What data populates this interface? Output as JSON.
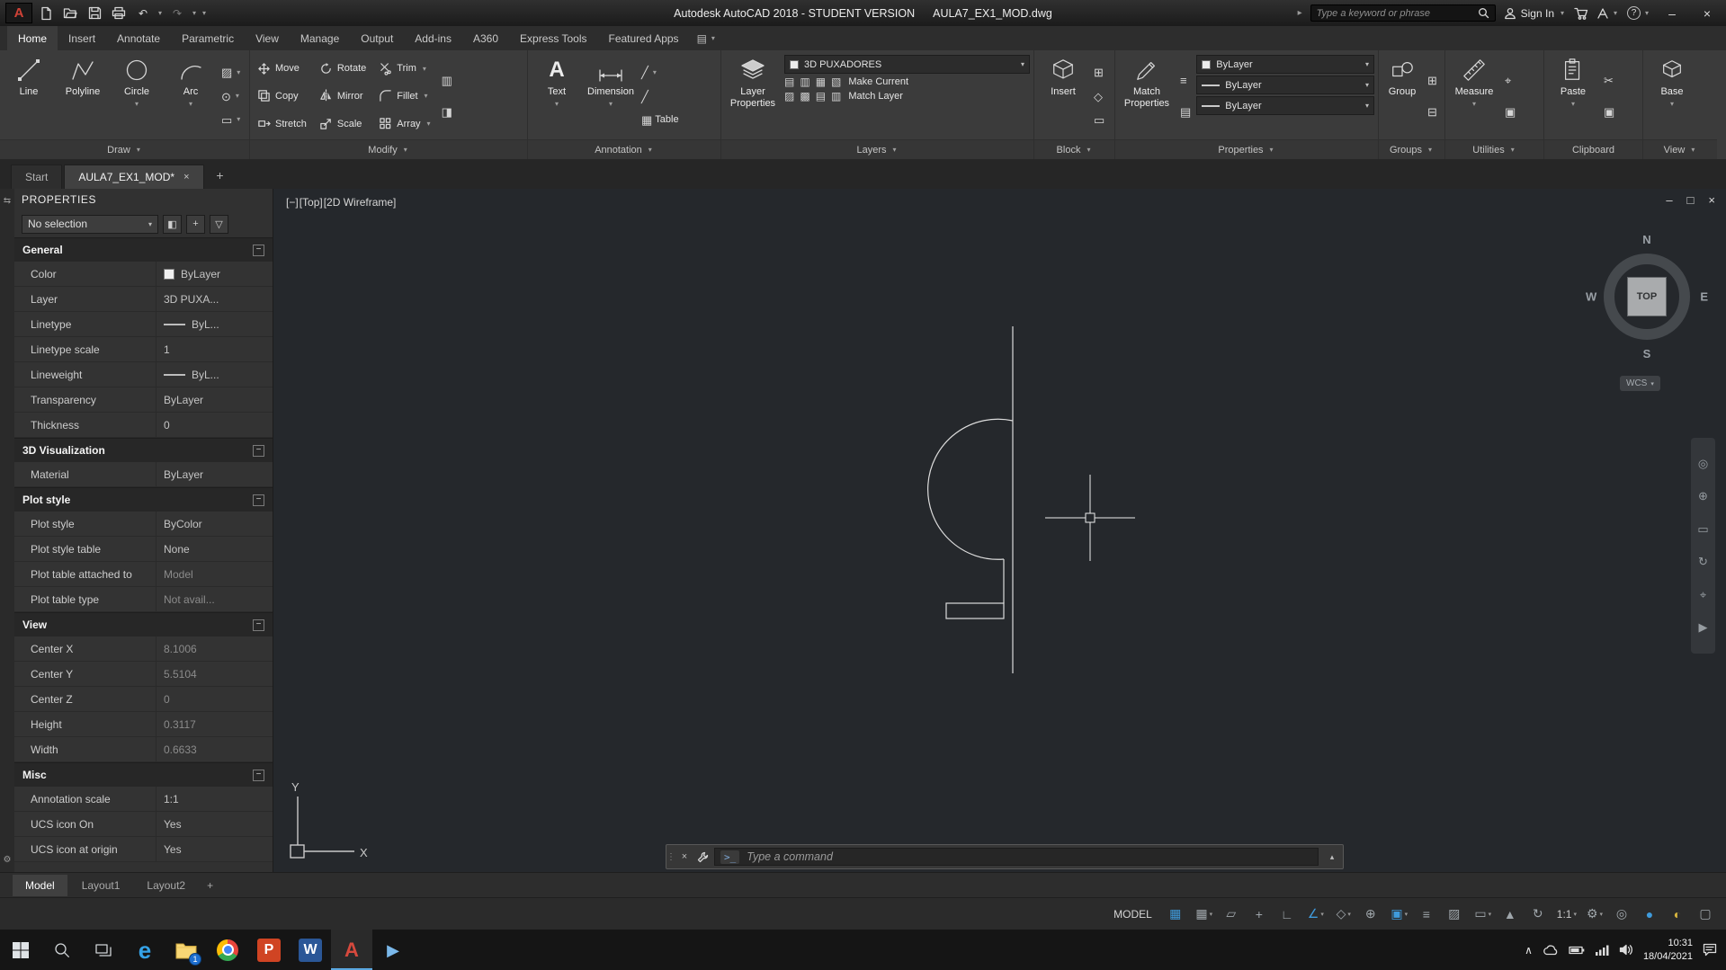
{
  "ui": {
    "caret": "▾",
    "caret_up": "▴",
    "minimize": "–",
    "maximize": "□",
    "close": "×",
    "plus": "+",
    "minus": "−",
    "chevron_right": "▸",
    "grip": "⋮",
    "help": "?",
    "undo": "↶",
    "redo": "↷"
  },
  "titlebar": {
    "app_title": "Autodesk AutoCAD 2018 - STUDENT VERSION",
    "doc_name": "AULA7_EX1_MOD.dwg",
    "search_placeholder": "Type a keyword or phrase",
    "sign_in": "Sign In"
  },
  "file_tabs": {
    "start": "Start",
    "active": "AULA7_EX1_MOD*"
  },
  "ribbon": {
    "tabs": [
      {
        "label": "Home",
        "cls": "active"
      },
      {
        "label": "Insert"
      },
      {
        "label": "Annotate"
      },
      {
        "label": "Parametric"
      },
      {
        "label": "View"
      },
      {
        "label": "Manage"
      },
      {
        "label": "Output"
      },
      {
        "label": "Add-ins"
      },
      {
        "label": "A360"
      },
      {
        "label": "Express Tools"
      },
      {
        "label": "Featured Apps"
      }
    ],
    "tab_options_glyph": "▤",
    "draw": {
      "label": "Draw",
      "line": "Line",
      "polyline": "Polyline",
      "circle": "Circle",
      "arc": "Arc",
      "flyouts": [
        {
          "g": "▨"
        },
        {
          "g": "⊙"
        },
        {
          "g": "▭"
        }
      ]
    },
    "modify": {
      "label": "Modify",
      "move": "Move",
      "rotate": "Rotate",
      "trim": "Trim",
      "copy": "Copy",
      "mirror": "Mirror",
      "fillet": "Fillet",
      "stretch": "Stretch",
      "scale": "Scale",
      "array": "Array",
      "extra": [
        {
          "g": "▥"
        },
        {
          "g": "◨"
        }
      ]
    },
    "annotation": {
      "label": "Annotation",
      "text": "Text",
      "dimension": "Dimension",
      "table": "Table",
      "text_icon": "A",
      "table_icon": "▦",
      "leader_icon": "╱"
    },
    "layers": {
      "label": "Layers",
      "layer_properties": "Layer Properties",
      "current_layer": "3D PUXADORES",
      "make_current": "Make Current",
      "match_layer": "Match Layer",
      "icons1": [
        "▤",
        "▥",
        "▦",
        "▧"
      ],
      "icons2": [
        "▨",
        "▩",
        "▤",
        "▥"
      ]
    },
    "block": {
      "label": "Block",
      "insert": "Insert",
      "icons": [
        "⊞",
        "◇",
        "▭"
      ]
    },
    "props": {
      "label": "Properties",
      "match_properties": "Match Properties",
      "color_value": "ByLayer",
      "linetype_value": "ByLayer",
      "lineweight_value": "ByLayer",
      "icons": [
        "≡",
        "▤"
      ]
    },
    "groups": {
      "label": "Groups",
      "group": "Group",
      "icons": [
        "⊞",
        "⊟"
      ]
    },
    "utilities": {
      "label": "Utilities",
      "measure": "Measure",
      "icons": [
        "⌖",
        "▣"
      ]
    },
    "clipboard": {
      "label": "Clipboard",
      "paste": "Paste",
      "icons": [
        "✂",
        "▣"
      ]
    },
    "view": {
      "label": "View",
      "base": "Base"
    }
  },
  "palette": {
    "title": "PROPERTIES",
    "selector": "No selection",
    "autohide_glyph": "⇆",
    "menu_glyph": "⚙",
    "btn_toggle": "◧",
    "btn_pickadd": "+",
    "btn_quick": "▽",
    "sections": {
      "general": {
        "title": "General",
        "rows": [
          {
            "label": "Color",
            "value": "ByLayer",
            "cls": "swatch-v"
          },
          {
            "label": "Layer",
            "value": "3D  PUXA..."
          },
          {
            "label": "Linetype",
            "value": "ByL...",
            "cls": "linetype-v"
          },
          {
            "label": "Linetype scale",
            "value": "1"
          },
          {
            "label": "Lineweight",
            "value": "ByL...",
            "cls": "linetype-v"
          },
          {
            "label": "Transparency",
            "value": "ByLayer"
          },
          {
            "label": "Thickness",
            "value": "0"
          }
        ]
      },
      "viz": {
        "title": "3D Visualization",
        "rows": [
          {
            "label": "Material",
            "value": "ByLayer"
          }
        ]
      },
      "plot": {
        "title": "Plot style",
        "rows": [
          {
            "label": "Plot style",
            "value": "ByColor"
          },
          {
            "label": "Plot style table",
            "value": "None"
          },
          {
            "label": "Plot table attached to",
            "value": "Model",
            "cls": "dim"
          },
          {
            "label": "Plot table type",
            "value": "Not avail...",
            "cls": "dim"
          }
        ]
      },
      "view": {
        "title": "View",
        "rows": [
          {
            "label": "Center X",
            "value": "8.1006",
            "cls": "dim"
          },
          {
            "label": "Center Y",
            "value": "5.5104",
            "cls": "dim"
          },
          {
            "label": "Center Z",
            "value": "0",
            "cls": "dim"
          },
          {
            "label": "Height",
            "value": "0.3117",
            "cls": "dim"
          },
          {
            "label": "Width",
            "value": "0.6633",
            "cls": "dim"
          }
        ]
      },
      "misc": {
        "title": "Misc",
        "rows": [
          {
            "label": "Annotation scale",
            "value": "1:1"
          },
          {
            "label": "UCS icon On",
            "value": "Yes"
          },
          {
            "label": "UCS icon at origin",
            "value": "Yes"
          }
        ]
      }
    }
  },
  "canvas": {
    "vp_minus": "[−]",
    "vp_top": "[Top]",
    "vp_style": "[2D Wireframe]",
    "viewcube": {
      "n": "N",
      "s": "S",
      "e": "E",
      "w": "W",
      "face": "TOP"
    },
    "wcs_label": "WCS",
    "ucs_x": "X",
    "ucs_y": "Y",
    "navbar_icons": [
      {
        "g": "◎"
      },
      {
        "g": "⊕"
      },
      {
        "g": "▭"
      },
      {
        "g": "↻"
      },
      {
        "g": "⌖"
      },
      {
        "g": "▶"
      }
    ]
  },
  "command": {
    "prompt": ">_",
    "placeholder": "Type a command"
  },
  "layout": {
    "tabs": [
      {
        "label": "Model",
        "cls": "active"
      },
      {
        "label": "Layout1"
      },
      {
        "label": "Layout2"
      }
    ]
  },
  "statusbar": {
    "model_label": "MODEL",
    "icons": [
      {
        "name": "grid-display",
        "glyph": "▦",
        "cls": "blue"
      },
      {
        "name": "snap-mode",
        "glyph": "▦",
        "caret_glyph": "▾"
      },
      {
        "name": "infer-constraints",
        "glyph": "▱"
      },
      {
        "name": "dynamic-input",
        "glyph": "+"
      },
      {
        "name": "ortho-mode",
        "glyph": "∟"
      },
      {
        "name": "polar-tracking",
        "glyph": "∠",
        "cls": "blue",
        "caret_glyph": "▾"
      },
      {
        "name": "isometric-drafting",
        "glyph": "◇",
        "caret_glyph": "▾"
      },
      {
        "name": "object-snap-tracking",
        "glyph": "⊕"
      },
      {
        "name": "object-snap",
        "glyph": "▣",
        "cls": "blue",
        "caret_glyph": "▾"
      },
      {
        "name": "lineweight-display",
        "glyph": "≡"
      },
      {
        "name": "transparency",
        "glyph": "▨"
      },
      {
        "name": "selection-cycling",
        "glyph": "▭",
        "caret_glyph": "▾"
      },
      {
        "name": "annotation-visibility",
        "glyph": "▲"
      },
      {
        "name": "autoscale",
        "glyph": "↻"
      },
      {
        "name": "annotation-scale",
        "glyph": "1:1",
        "cls": "text",
        "caret_glyph": "▾"
      },
      {
        "name": "workspace-switching",
        "glyph": "⚙",
        "caret_glyph": "▾"
      },
      {
        "name": "annotation-monitor",
        "glyph": "◎"
      },
      {
        "name": "graphics-performance",
        "glyph": "●",
        "cls": "blue"
      },
      {
        "name": "isolate-objects",
        "glyph": "◐",
        "cls": "yellow"
      },
      {
        "name": "clean-screen",
        "glyph": "▢"
      }
    ]
  },
  "taskbar": {
    "badge": "1",
    "time": "10:31",
    "date": "18/04/2021",
    "edge_letter": "e",
    "powerpoint_letter": "P",
    "word_letter": "W",
    "autocad_letter": "A",
    "media_glyph": "▶",
    "tray_chevron": "∧"
  }
}
